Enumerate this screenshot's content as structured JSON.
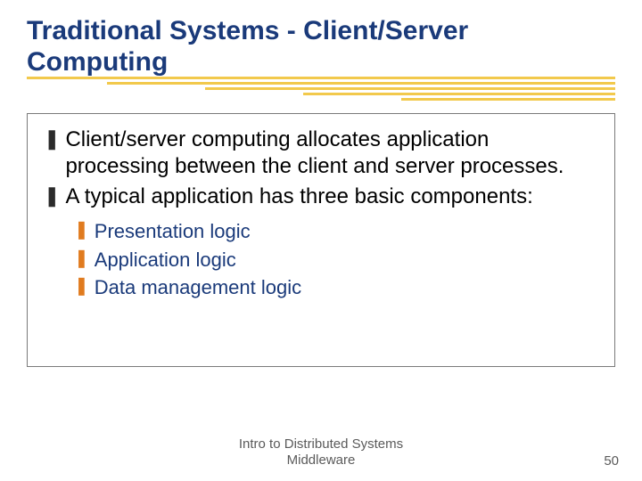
{
  "title": "Traditional Systems - Client/Server Computing",
  "bullets": [
    "Client/server computing allocates application processing between the client and server processes.",
    "A typical application has three basic components:"
  ],
  "sub_bullets": [
    "Presentation logic",
    "Application logic",
    "Data management logic"
  ],
  "footer": {
    "line1": "Intro to Distributed Systems",
    "line2": "Middleware"
  },
  "page_number": "50",
  "marks": {
    "main": "❚",
    "sub": "❚"
  }
}
